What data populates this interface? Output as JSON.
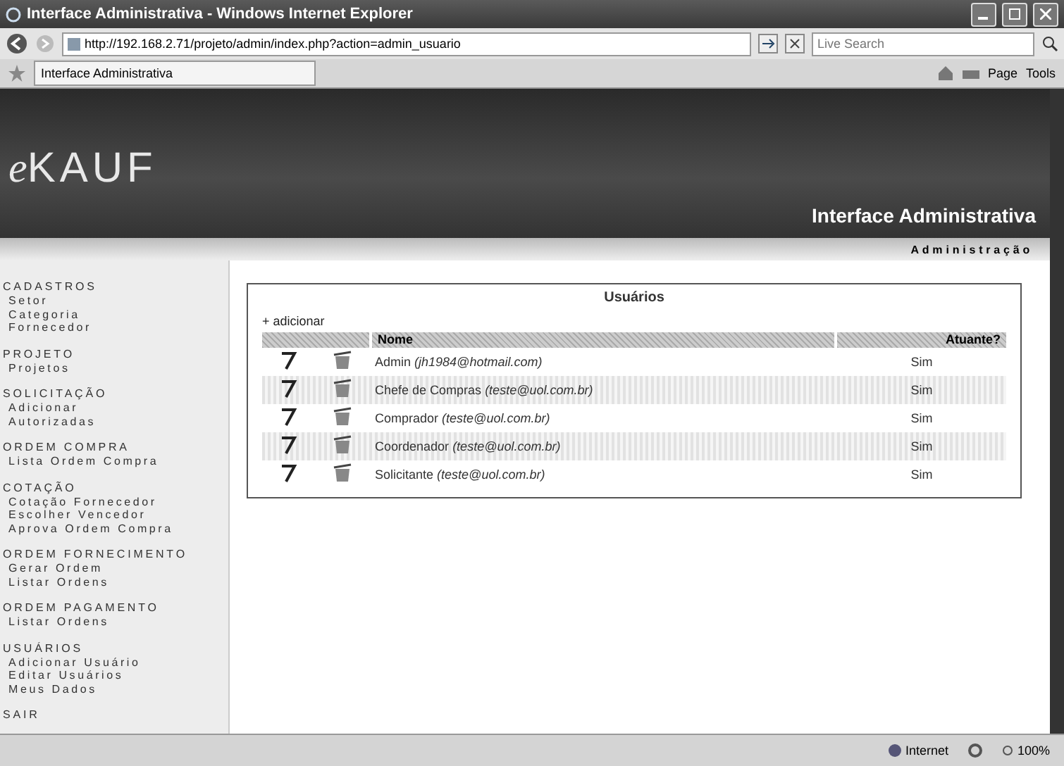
{
  "window": {
    "title": "Interface Administrativa - Windows Internet Explorer"
  },
  "address_bar": {
    "url": "http://192.168.2.71/projeto/admin/index.php?action=admin_usuario",
    "search_placeholder": "Live Search"
  },
  "tab_bar": {
    "tabs": [
      {
        "label": "Interface Administrativa",
        "selected": true
      }
    ],
    "tools": [
      "Page",
      "Tools"
    ]
  },
  "header": {
    "logo_prefix": "e",
    "logo": "KAUF",
    "title": "Interface Administrativa",
    "subtitle": "Administração"
  },
  "sidebar": {
    "sections": [
      {
        "title": "CADASTROS",
        "items": [
          "Setor",
          "Categoria",
          "Fornecedor"
        ]
      },
      {
        "title": "PROJETO",
        "items": [
          "Projetos"
        ]
      },
      {
        "title": "SOLICITAÇÃO",
        "items": [
          "Adicionar",
          "Autorizadas"
        ]
      },
      {
        "title": "ORDEM COMPRA",
        "items": [
          "Lista Ordem Compra"
        ]
      },
      {
        "title": "COTAÇÃO",
        "items": [
          "Cotação Fornecedor",
          "Escolher Vencedor",
          "Aprova Ordem Compra"
        ]
      },
      {
        "title": "ORDEM FORNECIMENTO",
        "items": [
          "Gerar Ordem",
          "Listar Ordens"
        ]
      },
      {
        "title": "ORDEM PAGAMENTO",
        "items": [
          "Listar Ordens"
        ]
      },
      {
        "title": "USUÁRIOS",
        "items": [
          "Adicionar Usuário",
          "Editar Usuários",
          "Meus Dados"
        ]
      },
      {
        "title": "SAIR"
      }
    ]
  },
  "panel": {
    "title": "Usuários",
    "add_link": "+ adicionar",
    "columns": [
      "Nome",
      "Atuante?"
    ],
    "rows": [
      {
        "name": "Admin",
        "email": "(jh1984@hotmail.com)",
        "active": "Sim"
      },
      {
        "name": "Chefe de Compras",
        "email": "(teste@uol.com.br)",
        "active": "Sim"
      },
      {
        "name": "Comprador",
        "email": "(teste@uol.com.br)",
        "active": "Sim"
      },
      {
        "name": "Coordenador",
        "email": "(teste@uol.com.br)",
        "active": "Sim"
      },
      {
        "name": "Solicitante",
        "email": "(teste@uol.com.br)",
        "active": "Sim"
      }
    ]
  },
  "status_bar": {
    "zone": "Internet",
    "zoom": "100%"
  }
}
